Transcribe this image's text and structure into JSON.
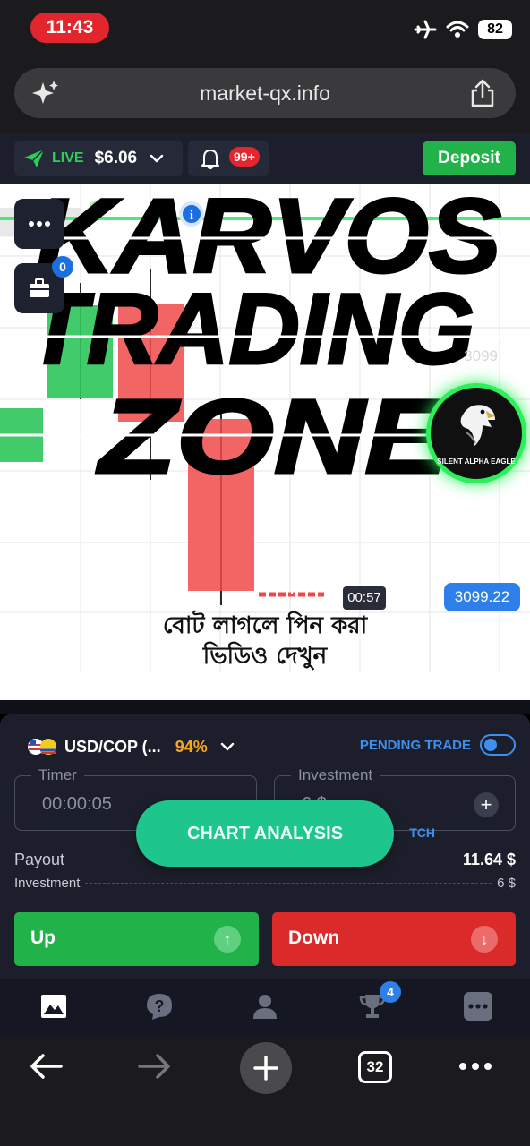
{
  "status_bar": {
    "time": "11:43",
    "battery": "82",
    "icons": [
      "airplane-icon",
      "wifi-icon",
      "battery-icon"
    ]
  },
  "browser": {
    "url": "market-qx.info",
    "tabs_count": "32"
  },
  "header": {
    "account_mode": "LIVE",
    "balance": "$6.06",
    "notifications_badge": "99+",
    "deposit_label": "Deposit"
  },
  "chart": {
    "portfolio_badge": "0",
    "ghost_price": "3099",
    "current_price": "3099.22",
    "countdown": "00:57",
    "overlay_title_lines": [
      "KARVOS",
      "TRADING",
      "ZONE"
    ],
    "avatar_label": "SILENT ALPHA EAGLE",
    "caption_line1": "বোট লাগলে পিন করা",
    "caption_line2": "ভিডিও দেখুন"
  },
  "trade_panel": {
    "asset": "USD/COP (...",
    "payout_percent": "94%",
    "pending_trade_label": "PENDING TRADE",
    "timer_legend": "Timer",
    "timer_value": "00:00:05",
    "investment_legend": "Investment",
    "investment_value": "6 $",
    "switch_label": "TCH",
    "chart_analysis_label": "CHART ANALYSIS",
    "payout_label": "Payout",
    "payout_value": "11.64 $",
    "investment_row_label": "Investment",
    "investment_row_value": "6 $",
    "up_label": "Up",
    "down_label": "Down"
  },
  "bottom_nav": {
    "items": [
      "chart-icon",
      "help-icon",
      "profile-icon",
      "trophy-icon",
      "more-icon"
    ],
    "trophy_badge": "4"
  },
  "colors": {
    "green": "#21b34a",
    "red": "#e3262e",
    "blue": "#2f7fe8",
    "teal": "#1ec58c",
    "panel": "#1c1f2b"
  }
}
